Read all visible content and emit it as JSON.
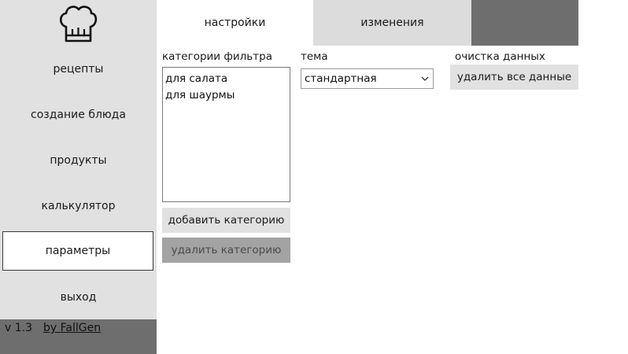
{
  "sidebar": {
    "logo_icon": "chef-hat-icon",
    "items": [
      {
        "label": "рецепты"
      },
      {
        "label": "создание блюда"
      },
      {
        "label": "продукты"
      },
      {
        "label": "калькулятор"
      },
      {
        "label": "параметры",
        "active": true
      },
      {
        "label": "выход"
      }
    ],
    "version": "v 1.3",
    "author_link": "by FallGen"
  },
  "tabs": [
    {
      "label": "настройки",
      "active": true
    },
    {
      "label": "изменения"
    }
  ],
  "filter_categories": {
    "label": "категории фильтра",
    "items": [
      "для салата",
      "для шаурмы"
    ],
    "add_button": "добавить категорию",
    "delete_button": "удалить категорию"
  },
  "theme": {
    "label": "тема",
    "selected": "стандартная"
  },
  "data_cleanup": {
    "label": "очистка данных",
    "button": "удалить все данные"
  },
  "colors": {
    "sidebar_bg": "#e1e1e1",
    "dark_panel": "#6e6e6e",
    "disabled_button": "#a3a3a3"
  }
}
